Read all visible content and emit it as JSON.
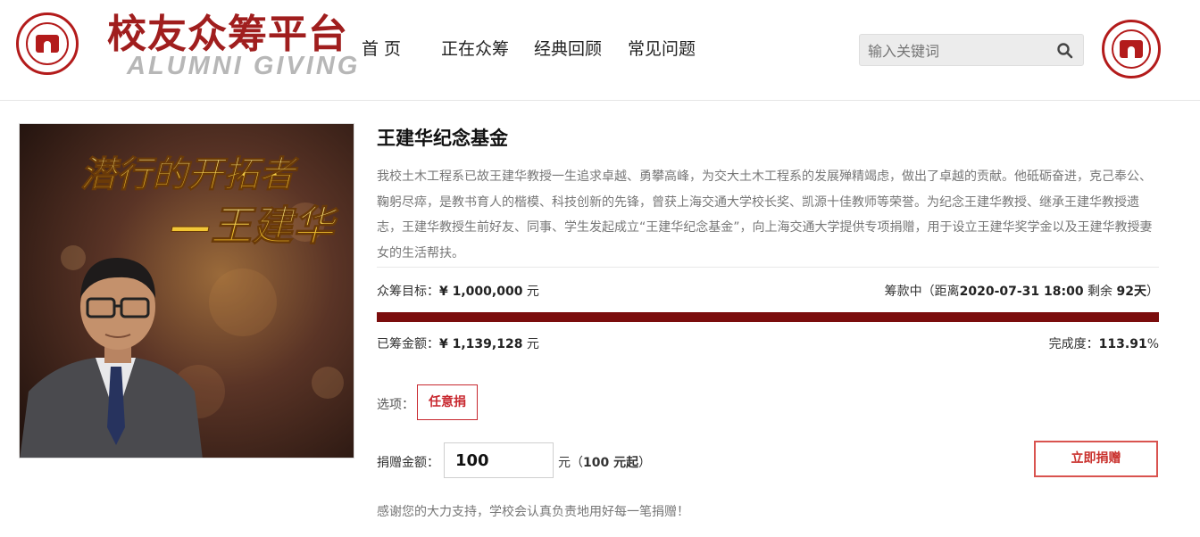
{
  "header": {
    "brand_cn": "校友众筹平台",
    "brand_en": "ALUMNI GIVING",
    "nav": [
      {
        "label": "首 页"
      },
      {
        "label": "正在众筹"
      },
      {
        "label": "经典回顾"
      },
      {
        "label": "常见问题"
      }
    ],
    "search": {
      "placeholder": "输入关键词"
    },
    "icons": [
      "university-seal-icon",
      "search-icon"
    ]
  },
  "project": {
    "cover_text_line1": "潜行的开拓者",
    "cover_text_line2": "—王建华",
    "title": "王建华纪念基金",
    "description": "我校土木工程系已故王建华教授一生追求卓越、勇攀高峰，为交大土木工程系的发展殚精竭虑，做出了卓越的贡献。他砥砺奋进，克己奉公、鞠躬尽瘁，是教书育人的楷模、科技创新的先锋，曾获上海交通大学校长奖、凯源十佳教师等荣誉。为纪念王建华教授、继承王建华教授遗志，王建华教授生前好友、同事、学生发起成立“王建华纪念基金”，向上海交通大学提供专项捐赠，用于设立王建华奖学金以及王建华教授妻女的生活帮扶。",
    "goal": {
      "label": "众筹目标：",
      "value": "¥ 1,000,000",
      "unit": " 元"
    },
    "status": {
      "prefix": "筹款中（距离",
      "deadline": "2020-07-31 18:00",
      "mid": " 剩余 ",
      "days": "92天",
      "suffix": "）"
    },
    "progress_fraction": 1.0,
    "raised": {
      "label": "已筹金额：",
      "value": "¥ 1,139,128",
      "unit": " 元"
    },
    "completion": {
      "label": "完成度：",
      "value": "113.91",
      "unit": "%"
    },
    "options_label": "选项：",
    "option": "任意捐",
    "amount_label": "捐赠金额：",
    "amount_value": "100",
    "amount_unit_prefix": "元（",
    "amount_min": "100 元起",
    "amount_unit_suffix": "）",
    "donate_button": "立即捐赠",
    "thanks": "感谢您的大力支持，学校会认真负责地用好每一笔捐赠！"
  },
  "colors": {
    "brand_red": "#a01e1e",
    "progress": "#7b0d0d",
    "button_border": "#d9534f"
  }
}
